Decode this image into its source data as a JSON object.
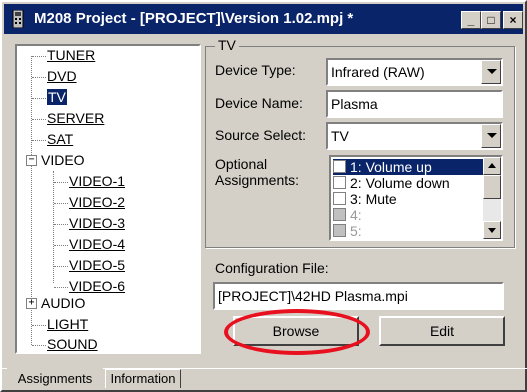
{
  "window": {
    "title": "M208 Project - [PROJECT]\\Version 1.02.mpj *"
  },
  "title_buttons": {
    "minimize": "_",
    "maximize": "□",
    "close": "×"
  },
  "tree": {
    "items": [
      {
        "label": "TUNER"
      },
      {
        "label": "DVD"
      },
      {
        "label": "TV",
        "selected": true
      },
      {
        "label": "SERVER"
      },
      {
        "label": "SAT"
      },
      {
        "label": "VIDEO",
        "expander": "−"
      },
      {
        "label": "VIDEO-1"
      },
      {
        "label": "VIDEO-2"
      },
      {
        "label": "VIDEO-3"
      },
      {
        "label": "VIDEO-4"
      },
      {
        "label": "VIDEO-5"
      },
      {
        "label": "VIDEO-6"
      },
      {
        "label": "AUDIO",
        "expander": "+"
      },
      {
        "label": "LIGHT"
      },
      {
        "label": "SOUND"
      }
    ]
  },
  "group": {
    "title": "TV",
    "device_type_label": "Device Type:",
    "device_type_value": "Infrared (RAW)",
    "device_name_label": "Device Name:",
    "device_name_value": "Plasma",
    "source_select_label": "Source Select:",
    "source_select_value": "TV",
    "optional_label_1": "Optional",
    "optional_label_2": "Assignments:",
    "assignments": [
      {
        "label": "1: Volume up",
        "selected": true
      },
      {
        "label": "2: Volume down"
      },
      {
        "label": "3:  Mute"
      },
      {
        "label": "4:",
        "disabled": true
      },
      {
        "label": "5:",
        "disabled": true
      }
    ]
  },
  "config": {
    "label": "Configuration File:",
    "value": "[PROJECT]\\42HD Plasma.mpi",
    "browse_label": "Browse",
    "edit_label": "Edit"
  },
  "tabs": [
    {
      "label": "Assignments",
      "active": true
    },
    {
      "label": "Information"
    }
  ],
  "colors": {
    "title_bar": "#0a246a",
    "highlight": "#0a246a",
    "annotation_circle": "#e8101e",
    "face": "#d4d0c8"
  }
}
